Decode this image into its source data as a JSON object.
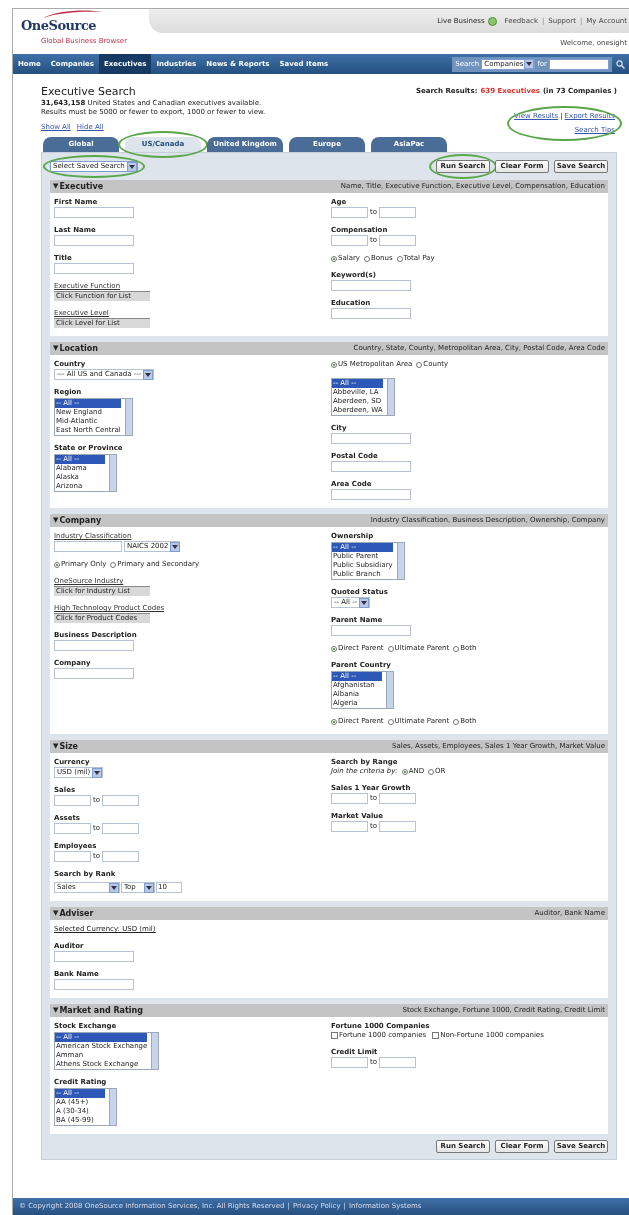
{
  "header": {
    "logo": "OneSource",
    "tagline": "Global Business Browser",
    "live_label": "Live Business",
    "top_links": [
      "Feedback",
      "Support",
      "My Account"
    ],
    "separator": "|",
    "welcome": "Welcome, onesight"
  },
  "nav": {
    "items": [
      {
        "label": "Home",
        "selected": false
      },
      {
        "label": "Companies",
        "selected": false
      },
      {
        "label": "Executives",
        "selected": true
      },
      {
        "label": "Industries",
        "selected": false
      },
      {
        "label": "News & Reports",
        "selected": false
      },
      {
        "label": "Saved Items",
        "selected": false
      }
    ],
    "search_label": "Search",
    "search_scope": "Companies",
    "for_label": "for"
  },
  "page": {
    "title": "Executive Search",
    "available": "**31,643,158** United States and Canadian executives available.",
    "limits": "Results must be 5000 or fewer to export, 1000 or fewer to view.",
    "results_label": "Search Results:",
    "results_count": "639 Executives",
    "results_rest": "(in 73 Companies )",
    "toggles": [
      "Show All",
      "Hide All"
    ],
    "results_links": {
      "highlighted": true,
      "links": [
        "View Results",
        "Export Results"
      ],
      "separator": "|",
      "tips": "Search Tips"
    }
  },
  "tabs": [
    {
      "label": "Global",
      "selected": false,
      "highlighted": false
    },
    {
      "label": "US/Canada",
      "selected": true,
      "highlighted": true
    },
    {
      "label": "United Kingdom",
      "selected": false,
      "highlighted": false
    },
    {
      "label": "Europe",
      "selected": false,
      "highlighted": false
    },
    {
      "label": "AsiaPac",
      "selected": false,
      "highlighted": false
    }
  ],
  "saved_search": {
    "value": "Select Saved Search",
    "highlighted": true
  },
  "top_buttons": [
    {
      "label": "Run Search",
      "highlighted": true
    },
    {
      "label": "Clear Form",
      "highlighted": false
    },
    {
      "label": "Save Search",
      "highlighted": false
    }
  ],
  "sections": [
    {
      "toggle": "▼",
      "title": "Executive",
      "summary": "Name, Title, Executive Function, Executive Level, Compensation, Education",
      "left": [
        {
          "kind": "text",
          "label": "First Name"
        },
        {
          "kind": "text",
          "label": "Last Name"
        },
        {
          "kind": "text",
          "label": "Title"
        },
        {
          "kind": "lookup",
          "label": "Executive Function",
          "button": "Click Function for List"
        },
        {
          "kind": "lookup",
          "label": "Executive Level",
          "button": "Click Level for List"
        }
      ],
      "right": [
        {
          "kind": "range",
          "label": "Age",
          "to": "to"
        },
        {
          "kind": "range",
          "label": "Compensation",
          "to": "to"
        },
        {
          "kind": "radios",
          "options": [
            {
              "text": "Salary",
              "selected": true
            },
            {
              "text": "Bonus",
              "selected": false
            },
            {
              "text": "Total Pay",
              "selected": false
            }
          ]
        },
        {
          "kind": "text",
          "label": "Keyword(s)"
        },
        {
          "kind": "text",
          "label": "Education"
        }
      ]
    },
    {
      "toggle": "▼",
      "title": "Location",
      "summary": "Country, State, County, Metropolitan Area, City, Postal Code, Area Code",
      "left": [
        {
          "kind": "dropdown",
          "label": "Country",
          "value": "--- All US and Canada ---"
        },
        {
          "kind": "listbox",
          "label": "Region",
          "options": [
            {
              "text": "-- All --",
              "selected": true
            },
            {
              "text": "New England",
              "selected": false
            },
            {
              "text": "Mid-Atlantic",
              "selected": false
            },
            {
              "text": "East North Central",
              "selected": false
            }
          ]
        },
        {
          "kind": "listbox",
          "label": "State or Province",
          "options": [
            {
              "text": "-- All --",
              "selected": true
            },
            {
              "text": "Alabama",
              "selected": false
            },
            {
              "text": "Alaska",
              "selected": false
            },
            {
              "text": "Arizona",
              "selected": false
            }
          ]
        }
      ],
      "right": [
        {
          "kind": "radios",
          "options": [
            {
              "text": "US Metropolitan Area",
              "selected": true
            },
            {
              "text": "County",
              "selected": false
            }
          ]
        },
        {
          "kind": "listbox",
          "options": [
            {
              "text": "-- All --",
              "selected": true
            },
            {
              "text": "Abbeville, LA",
              "selected": false
            },
            {
              "text": "Aberdeen, SD",
              "selected": false
            },
            {
              "text": "Aberdeen, WA",
              "selected": false
            }
          ]
        },
        {
          "kind": "text",
          "label": "City"
        },
        {
          "kind": "text",
          "label": "Postal Code"
        },
        {
          "kind": "text",
          "label": "Area Code"
        }
      ]
    },
    {
      "toggle": "▼",
      "title": "Company",
      "summary": "Industry Classification, Business Description, Ownership, Company",
      "left": [
        {
          "kind": "combo",
          "label": "Industry Classification",
          "dropdown": "NAICS 2002"
        },
        {
          "kind": "radios",
          "options": [
            {
              "text": "Primary Only",
              "selected": true
            },
            {
              "text": "Primary and Secondary",
              "selected": false
            }
          ]
        },
        {
          "kind": "lookup",
          "label": "OneSource Industry",
          "button": "Click for Industry List"
        },
        {
          "kind": "lookup",
          "label": "High Technology Product Codes",
          "button": "Click for Product Codes"
        },
        {
          "kind": "text",
          "label": "Business Description"
        },
        {
          "kind": "text",
          "label": "Company"
        }
      ],
      "right": [
        {
          "kind": "listbox",
          "label": "Ownership",
          "options": [
            {
              "text": "-- All --",
              "selected": true
            },
            {
              "text": "Public Parent",
              "selected": false
            },
            {
              "text": "Public Subsidiary",
              "selected": false
            },
            {
              "text": "Public Branch",
              "selected": false
            }
          ]
        },
        {
          "kind": "dropdown",
          "label": "Quoted Status",
          "value": "-- All --"
        },
        {
          "kind": "text",
          "label": "Parent Name"
        },
        {
          "kind": "radios",
          "options": [
            {
              "text": "Direct Parent",
              "selected": true
            },
            {
              "text": "Ultimate Parent",
              "selected": false
            },
            {
              "text": "Both",
              "selected": false
            }
          ]
        },
        {
          "kind": "listbox",
          "label": "Parent Country",
          "options": [
            {
              "text": "-- All --",
              "selected": true
            },
            {
              "text": "Afghanistan",
              "selected": false
            },
            {
              "text": "Albania",
              "selected": false
            },
            {
              "text": "Algeria",
              "selected": false
            }
          ]
        },
        {
          "kind": "radios",
          "options": [
            {
              "text": "Direct Parent",
              "selected": true
            },
            {
              "text": "Ultimate Parent",
              "selected": false
            },
            {
              "text": "Both",
              "selected": false
            }
          ]
        }
      ]
    },
    {
      "toggle": "▼",
      "title": "Size",
      "summary": "Sales, Assets, Employees, Sales 1 Year Growth, Market Value",
      "left": [
        {
          "kind": "dropdown",
          "label": "Currency",
          "value": "USD (mil)"
        },
        {
          "kind": "range",
          "label": "Sales",
          "to": "to"
        },
        {
          "kind": "range",
          "label": "Assets",
          "to": "to"
        },
        {
          "kind": "range",
          "label": "Employees",
          "to": "to"
        },
        {
          "kind": "rank",
          "label": "Search by Rank",
          "by": "Sales",
          "direction": "Top",
          "count": "10"
        }
      ],
      "right": [
        {
          "kind": "radios",
          "label": "Search by Range",
          "prompt": "Join the criteria by:",
          "options": [
            {
              "text": "AND",
              "selected": true
            },
            {
              "text": "OR",
              "selected": false
            }
          ]
        },
        {
          "kind": "range",
          "label": "Sales 1 Year Growth",
          "to": "to"
        },
        {
          "kind": "range",
          "label": "Market Value",
          "to": "to"
        }
      ]
    },
    {
      "toggle": "▼",
      "title": "Adviser",
      "summary": "Auditor, Bank Name",
      "left": [
        {
          "kind": "note",
          "text": "Selected Currency: USD (mil)"
        },
        {
          "kind": "text",
          "label": "Auditor"
        },
        {
          "kind": "text",
          "label": "Bank Name"
        }
      ]
    },
    {
      "toggle": "▼",
      "title": "Market and Rating",
      "summary": "Stock Exchange, Fortune 1000, Credit Rating, Credit Limit",
      "left": [
        {
          "kind": "listbox",
          "label": "Stock Exchange",
          "options": [
            {
              "text": "-- All --",
              "selected": true
            },
            {
              "text": "American Stock Exchange",
              "selected": false
            },
            {
              "text": "Amman",
              "selected": false
            },
            {
              "text": "Athens Stock Exchange",
              "selected": false
            }
          ]
        },
        {
          "kind": "listbox",
          "label": "Credit Rating",
          "options": [
            {
              "text": "-- All --",
              "selected": true
            },
            {
              "text": "AA (45+)",
              "selected": false
            },
            {
              "text": "A (30-34)",
              "selected": false
            },
            {
              "text": "BA (45-99)",
              "selected": false
            }
          ]
        }
      ],
      "right": [
        {
          "kind": "checks",
          "label": "Fortune 1000 Companies",
          "options": [
            {
              "text": "Fortune 1000 companies",
              "checked": false
            },
            {
              "text": "Non-Fortune 1000 companies",
              "checked": false
            }
          ]
        },
        {
          "kind": "range",
          "label": "Credit Limit",
          "to": "to"
        }
      ]
    }
  ],
  "bottom_buttons": [
    "Run Search",
    "Clear Form",
    "Save Search"
  ],
  "footer": {
    "items": [
      "© Copyright 2008 OneSource Information Services, Inc. All Rights Reserved",
      "Privacy Policy",
      "Information Systems"
    ],
    "separator": "|"
  }
}
